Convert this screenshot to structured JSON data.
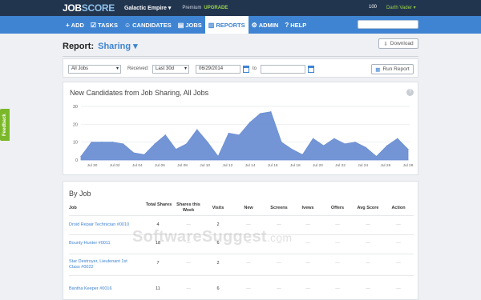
{
  "topbar": {
    "logo_a": "JOB",
    "logo_b": "SCORE",
    "company": "Galactic Empire ▾",
    "premium": "Premium",
    "upgrade": "UPGRADE",
    "points": "100",
    "user": "Darth Vader ▾"
  },
  "nav": {
    "items": [
      {
        "icon": "+",
        "label": "ADD"
      },
      {
        "icon": "☑",
        "label": "TASKS"
      },
      {
        "icon": "☺",
        "label": "CANDIDATES"
      },
      {
        "icon": "▤",
        "label": "JOBS"
      },
      {
        "icon": "▥",
        "label": "REPORTS"
      },
      {
        "icon": "⚙",
        "label": "ADMIN"
      },
      {
        "icon": "?",
        "label": "HELP"
      }
    ],
    "active": "REPORTS"
  },
  "report": {
    "label": "Report:",
    "selected": "Sharing ▾",
    "download_label": "Download"
  },
  "filters": {
    "jobs": "All Jobs",
    "received_label": "Received:",
    "period": "Last 30d",
    "from_date": "06/29/2014",
    "to_label": "to",
    "to_date": "",
    "run_label": "Run Report"
  },
  "chart": {
    "help": "?"
  },
  "chart_data": {
    "type": "area",
    "title": "New Candidates from Job Sharing, All Jobs",
    "xlabel": "",
    "ylabel": "",
    "ylim": [
      0,
      30
    ],
    "yticks": [
      0,
      10,
      20,
      30
    ],
    "xticks": [
      "Jul 30",
      "Jul 02",
      "Jul 04",
      "Jul 06",
      "Jul 08",
      "Jul 10",
      "Jul 12",
      "Jul 14",
      "Jul 16",
      "Jul 18",
      "Jul 20",
      "Jul 22",
      "Jul 24",
      "Jul 26",
      "Jul 28"
    ],
    "grid": true,
    "color": "#6c8fd3",
    "series": [
      {
        "values": [
          2,
          10,
          10,
          10,
          9,
          4,
          3,
          9,
          14,
          6,
          9,
          17,
          10,
          2,
          15,
          14,
          21,
          26,
          27,
          10,
          6,
          3,
          12,
          8,
          12,
          9,
          10,
          7,
          2,
          8,
          12,
          6
        ]
      }
    ]
  },
  "table": {
    "heading": "By Job",
    "columns": [
      "Job",
      "Total Shares",
      "Shares this Week",
      "Visits",
      "New",
      "Screens",
      "Ivews",
      "Offers",
      "Avg Score",
      "Action"
    ],
    "rows": [
      {
        "job": "Droid Repair Technician #0010",
        "cells": [
          "4",
          "—",
          "2",
          "—",
          "—",
          "—",
          "—",
          "—",
          "—"
        ]
      },
      {
        "job": "Bounty Hunter #0011",
        "cells": [
          "18",
          "—",
          "6",
          "—",
          "—",
          "—",
          "—",
          "—",
          "—"
        ]
      },
      {
        "job": "Star Destroyer, Lieutenant 1st Class #0022",
        "cells": [
          "7",
          "—",
          "2",
          "—",
          "—",
          "—",
          "—",
          "—",
          "—"
        ]
      },
      {
        "job": "Bantha Keeper #0016",
        "cells": [
          "11",
          "—",
          "6",
          "—",
          "—",
          "—",
          "—",
          "—",
          "—"
        ]
      }
    ]
  },
  "feedback": "Feedback",
  "watermark": {
    "main": "SoftwareSuggest",
    "suffix": ".com"
  }
}
